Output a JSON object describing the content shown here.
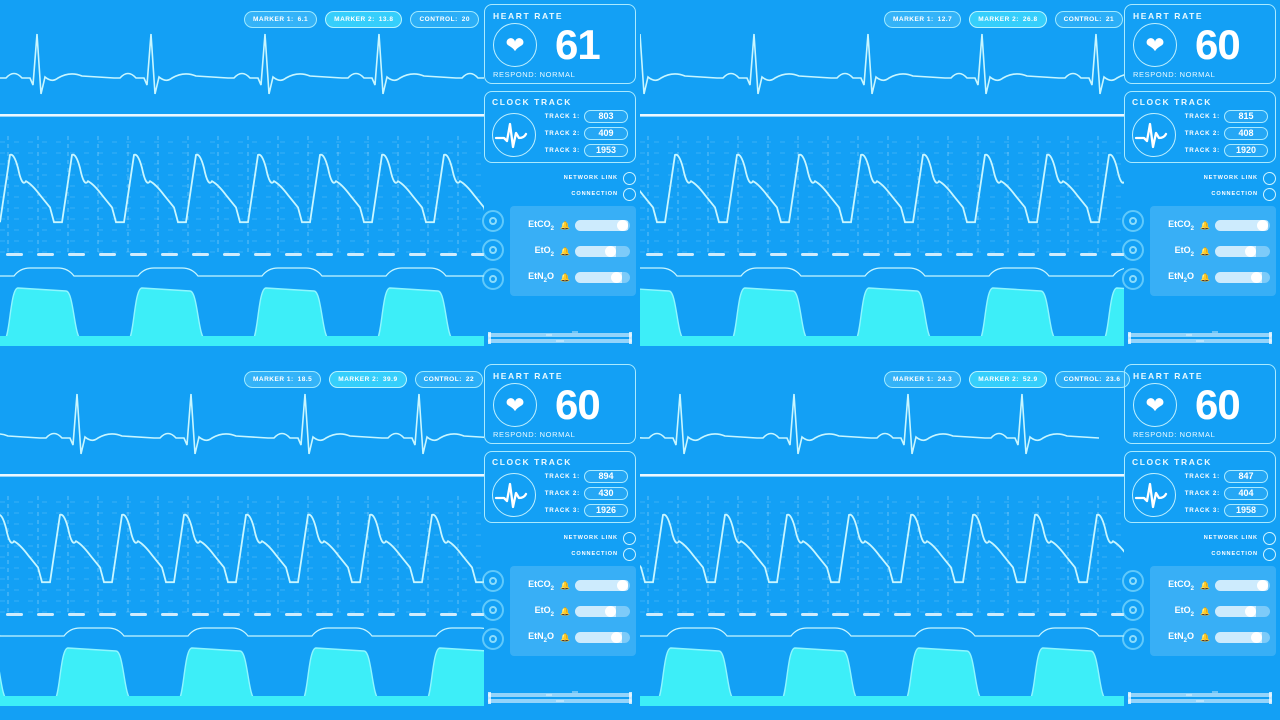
{
  "theme": {
    "background": "#13a0f5",
    "trace": "#c8f6ff",
    "accent_cyan": "#3deef8",
    "panel_border": "#a9eaff",
    "text": "#ffffff"
  },
  "labels": {
    "heart_rate_title": "HEART RATE",
    "respond": "RESPOND: NORMAL",
    "clock_track_title": "CLOCK TRACK",
    "track1": "TRACK 1:",
    "track2": "TRACK 2:",
    "track3": "TRACK 3:",
    "network_link": "NETWORK LINK",
    "connection": "CONNECTION",
    "marker1": "MARKER 1:",
    "marker2": "MARKER 2:",
    "control": "CONTROL:",
    "gas1": "EtCO",
    "gas1_sub": "2",
    "gas2": "EtO",
    "gas2_sub": "2",
    "gas3": "EtN",
    "gas3_sub": "2",
    "gas3_tail": "O",
    "heart_icon": "heart-icon",
    "bell_icon": "bell-icon",
    "ecg_icon": "ecg-waveform-icon"
  },
  "panels": [
    {
      "id": "top-left",
      "marker1": "6.1",
      "marker2": "13.8",
      "control": "20",
      "heart_rate": "61",
      "track1": "803",
      "track2": "409",
      "track3": "1953",
      "sliders": [
        96,
        74,
        86
      ]
    },
    {
      "id": "top-right",
      "marker1": "12.7",
      "marker2": "26.8",
      "control": "21",
      "heart_rate": "60",
      "track1": "815",
      "track2": "408",
      "track3": "1920",
      "sliders": [
        96,
        74,
        86
      ]
    },
    {
      "id": "bottom-left",
      "marker1": "18.5",
      "marker2": "39.9",
      "control": "22",
      "heart_rate": "60",
      "track1": "894",
      "track2": "430",
      "track3": "1926",
      "sliders": [
        96,
        74,
        86
      ]
    },
    {
      "id": "bottom-right",
      "marker1": "24.3",
      "marker2": "52.9",
      "control": "23.6",
      "heart_rate": "60",
      "track1": "847",
      "track2": "404",
      "track3": "1958",
      "sliders": [
        96,
        74,
        86
      ]
    }
  ]
}
